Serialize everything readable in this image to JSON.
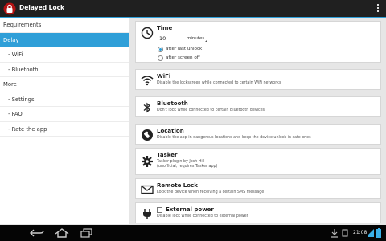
{
  "app": {
    "title": "Delayed Lock"
  },
  "sidebar": {
    "items": [
      {
        "label": "Requirements"
      },
      {
        "label": "Delay"
      },
      {
        "label": "- WiFi"
      },
      {
        "label": "- Bluetooth"
      },
      {
        "label": "More"
      },
      {
        "label": "- Settings"
      },
      {
        "label": "- FAQ"
      },
      {
        "label": "- Rate the app"
      }
    ],
    "selected": "Delay"
  },
  "time": {
    "title": "Time",
    "value": "10",
    "unit": "minutes",
    "options": [
      {
        "label": "after last unlock",
        "selected": true
      },
      {
        "label": "after screen off",
        "selected": false
      }
    ]
  },
  "cards": [
    {
      "title": "WiFi",
      "desc": "Disable the lockscreen while connected to certain WiFi networks",
      "icon": "wifi-icon"
    },
    {
      "title": "Bluetooth",
      "desc": "Don't lock while connected to certain Bluetooth devices",
      "icon": "bluetooth-icon"
    },
    {
      "title": "Location",
      "desc": "Disable the app in dangerous locations and keep the device unlock in safe ones",
      "icon": "location-icon"
    },
    {
      "title": "Tasker",
      "desc": "Tasker plugin by Josh Hill",
      "desc2": "(unofficial, requires Tasker app)",
      "icon": "tasker-icon"
    },
    {
      "title": "Remote Lock",
      "desc": "Lock the device when receiving a certain SMS message",
      "icon": "envelope-icon"
    },
    {
      "title": "External power",
      "desc": "Disable lock while connected to external power",
      "icon": "plug-icon",
      "checked": false
    }
  ],
  "status": {
    "time": "21:08"
  },
  "colors": {
    "accent": "#2f9fd8",
    "actionbar": "#202020"
  }
}
